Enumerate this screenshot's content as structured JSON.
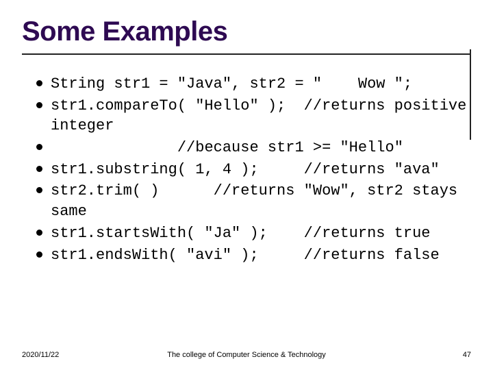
{
  "title": "Some Examples",
  "bullets": [
    "String str1 = \"Java\", str2 = \"    Wow \";",
    "str1.compareTo( \"Hello\" );  //returns positive integer",
    "              //because str1 >= \"Hello\"",
    "str1.substring( 1, 4 );     //returns \"ava\"",
    "str2.trim( )      //returns \"Wow\", str2 stays same",
    "str1.startsWith( \"Ja\" );    //returns true",
    "str1.endsWith( \"avi\" );     //returns false"
  ],
  "footer": {
    "date": "2020/11/22",
    "center": "The college of Computer Science & Technology",
    "page": "47"
  }
}
